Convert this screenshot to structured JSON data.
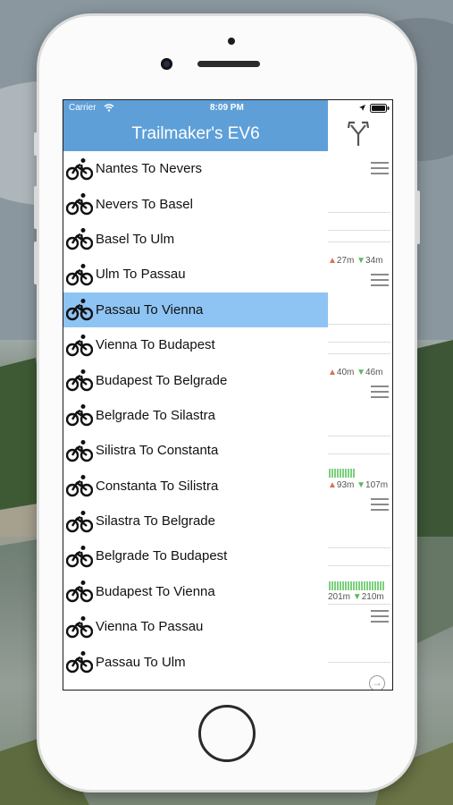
{
  "statusbar": {
    "carrier": "Carrier",
    "time": "8:09 PM"
  },
  "navbar": {
    "title": "Trailmaker's EV6"
  },
  "side_panel": {
    "elevations": [
      {
        "up": "27m",
        "down": "34m"
      },
      {
        "up": "40m",
        "down": "46m"
      },
      {
        "up": "93m",
        "down": "107m"
      },
      {
        "up": "201m",
        "down": "210m"
      }
    ]
  },
  "routes": [
    {
      "label": "Nantes To Nevers",
      "selected": false
    },
    {
      "label": "Nevers To Basel",
      "selected": false
    },
    {
      "label": "Basel To Ulm",
      "selected": false
    },
    {
      "label": "Ulm To Passau",
      "selected": false
    },
    {
      "label": "Passau To Vienna",
      "selected": true
    },
    {
      "label": "Vienna To Budapest",
      "selected": false
    },
    {
      "label": "Budapest To Belgrade",
      "selected": false
    },
    {
      "label": "Belgrade To Silastra",
      "selected": false
    },
    {
      "label": "Silistra To Constanta",
      "selected": false
    },
    {
      "label": "Constanta To Silistra",
      "selected": false
    },
    {
      "label": "Silastra To Belgrade",
      "selected": false
    },
    {
      "label": "Belgrade To Budapest",
      "selected": false
    },
    {
      "label": "Budapest To Vienna",
      "selected": false
    },
    {
      "label": "Vienna To Passau",
      "selected": false
    },
    {
      "label": "Passau To Ulm",
      "selected": false
    }
  ],
  "icons": {
    "route_icon": "bicycle-icon",
    "nav_action": "fork-arrows-icon",
    "row_menu": "menu-icon",
    "next": "arrow-right-circle-icon"
  },
  "colors": {
    "accent": "#5e9fd8",
    "selected_row": "#8ec4f3"
  }
}
